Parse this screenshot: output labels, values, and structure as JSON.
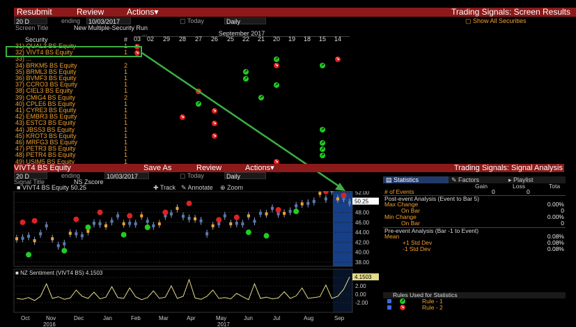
{
  "top_menu": {
    "resubmit": "Resubmit",
    "review": "Review",
    "actions": "Actions▾",
    "title": "Trading Signals: Screen Results"
  },
  "top_fields": {
    "period": "20 D",
    "ending_label": "ending",
    "ending": "10/03/2017",
    "today": "Today",
    "freq": "Daily",
    "show_all": "Show All Securities"
  },
  "screen_title": {
    "label": "Screen Title",
    "value": "New Multiple-Security Run"
  },
  "grid_header": {
    "month": "September 2017",
    "security": "Security",
    "count": "#",
    "dots": "..."
  },
  "dates": [
    "03",
    "02",
    "29",
    "28",
    "27",
    "26",
    "25",
    "22",
    "21",
    "20",
    "19",
    "18",
    "15",
    "14"
  ],
  "rows": [
    {
      "n": "31)",
      "name": "QUAL3 BS Equity",
      "count": "1"
    },
    {
      "n": "32)",
      "name": "VIVT4 BS Equity",
      "count": "1"
    },
    {
      "n": "33)",
      "name": "...",
      "count": ""
    },
    {
      "n": "34)",
      "name": "BRKM5 BS Equity",
      "count": "2"
    },
    {
      "n": "35)",
      "name": "BRML3 BS Equity",
      "count": "1"
    },
    {
      "n": "36)",
      "name": "BVMF3 BS Equity",
      "count": "1"
    },
    {
      "n": "37)",
      "name": "CCRO3 BS Equity",
      "count": "1"
    },
    {
      "n": "38)",
      "name": "CIEL3 BS Equity",
      "count": "1"
    },
    {
      "n": "39)",
      "name": "CMIG4 BS Equity",
      "count": "2"
    },
    {
      "n": "40)",
      "name": "CPLE6 BS Equity",
      "count": "1"
    },
    {
      "n": "41)",
      "name": "CYRE3 BS Equity",
      "count": "1"
    },
    {
      "n": "42)",
      "name": "EMBR3 BS Equity",
      "count": "1"
    },
    {
      "n": "43)",
      "name": "ESTC3 BS Equity",
      "count": "1"
    },
    {
      "n": "44)",
      "name": "JBSS3 BS Equity",
      "count": "1"
    },
    {
      "n": "45)",
      "name": "KROT3 BS Equity",
      "count": "1"
    },
    {
      "n": "46)",
      "name": "MRFG3 BS Equity",
      "count": "1"
    },
    {
      "n": "47)",
      "name": "PETR3 BS Equity",
      "count": "1"
    },
    {
      "n": "48)",
      "name": "PETR4 BS Equity",
      "count": "1"
    },
    {
      "n": "49)",
      "name": "USIM5 BS Equity",
      "count": "1"
    }
  ],
  "bottom_menu": {
    "security": "VIVT4 BS Equity",
    "save_as": "Save As",
    "review": "Review",
    "actions": "Actions▾",
    "title": "Trading Signals: Signal Analysis"
  },
  "bottom_fields": {
    "period": "20 D",
    "ending_label": "ending",
    "ending": "10/03/2017",
    "today": "Today",
    "freq": "Daily"
  },
  "signal_title": {
    "label": "Signal Title",
    "value": "NS Zscore"
  },
  "chart_toolbar": {
    "legend": "VIVT4 BS Equity 50.25",
    "track": "Track",
    "annotate": "Annotate",
    "zoom": "Zoom"
  },
  "sentiment_legend": "NZ Sentiment (VIVT4 BS) 4.1503",
  "price_tag": "50.25",
  "sent_tag": "4.1503",
  "price_ticks": [
    "52.00",
    "50.00",
    "48.00",
    "46.00",
    "44.00",
    "42.00",
    "40.00",
    "38.00"
  ],
  "sent_ticks": [
    "4.00",
    "2.00",
    "0.00",
    "-2.00"
  ],
  "months": [
    "Oct",
    "Nov",
    "Dec",
    "Jan",
    "Feb",
    "Mar",
    "Apr",
    "May",
    "Jun",
    "Jul",
    "Aug",
    "Sep"
  ],
  "years": [
    "2016",
    "2017"
  ],
  "stats_tabs": {
    "statistics": "Statistics",
    "factors": "Factors",
    "playlist": "Playlist"
  },
  "stats_header": {
    "gain": "Gain",
    "loss": "Loss",
    "total": "Tota"
  },
  "stats": {
    "events_label": "# of Events",
    "events_gain": "0",
    "events_loss": "0",
    "post_label": "Post-event Analysis (Event to Bar 5)",
    "max_change": "Max Change",
    "max_change_val": "0.00%",
    "on_bar1": "On Bar",
    "on_bar1_val": "0",
    "min_change": "Min Change",
    "min_change_val": "0.00%",
    "on_bar2": "On Bar",
    "on_bar2_val": "0",
    "pre_label": "Pre-event Analysis (Bar -1 to Event)",
    "mean": "Mean",
    "mean_val": "0.08%",
    "plus_std": "+1 Std Dev",
    "plus_std_val": "0.08%",
    "minus_std": "-1 Std Dev",
    "minus_std_val": "0.08%"
  },
  "rules": {
    "title": "Rules Used for Statistics",
    "rule1": "Rule - 1",
    "rule2": "Rule - 2"
  },
  "colors": {
    "accent_red": "#8c1a1a",
    "orange": "#f0a030",
    "signal_red": "#dd2222",
    "signal_green": "#22cc22",
    "arrow_green": "#3cb043",
    "highlight_blue": "#1a4aa0"
  }
}
